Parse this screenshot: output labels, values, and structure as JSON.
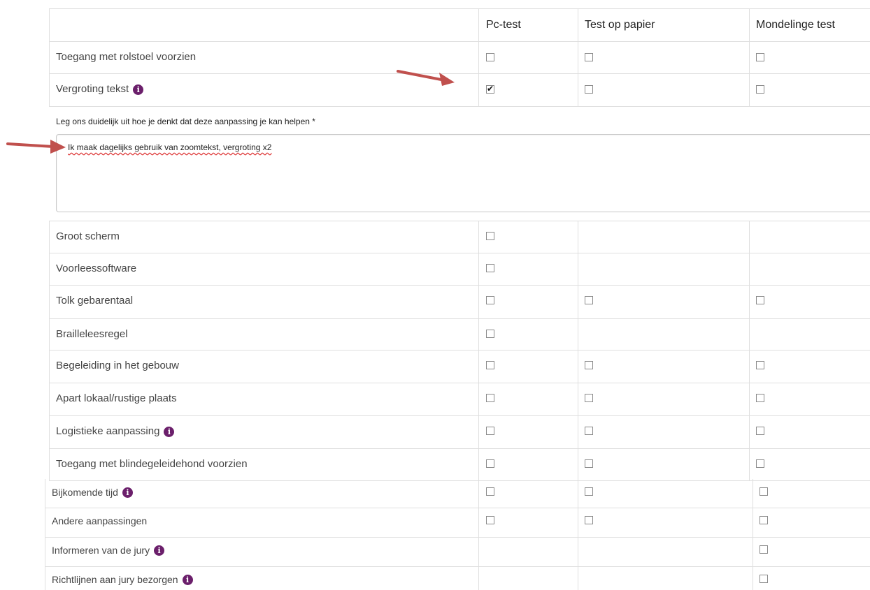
{
  "columns": [
    "Pc-test",
    "Test op papier",
    "Mondelinge test"
  ],
  "rows_top": [
    {
      "label": "Toegang met rolstoel voorzien",
      "info": false,
      "checks": [
        false,
        false,
        false
      ]
    },
    {
      "label": "Vergroting tekst",
      "info": true,
      "checks": [
        true,
        false,
        false
      ]
    }
  ],
  "explanation": {
    "label": "Leg ons duidelijk uit hoe je denkt dat deze aanpassing je kan helpen *",
    "value": "Ik maak dagelijks gebruik van zoomtekst, vergroting x2"
  },
  "rows_mid": [
    {
      "label": "Groot scherm",
      "info": false,
      "checks": [
        false,
        null,
        null
      ]
    },
    {
      "label": "Voorleessoftware",
      "info": false,
      "checks": [
        false,
        null,
        null
      ]
    },
    {
      "label": "Tolk gebarentaal",
      "info": false,
      "checks": [
        false,
        false,
        false
      ]
    },
    {
      "label": "Brailleleesregel",
      "info": false,
      "checks": [
        false,
        null,
        null
      ]
    },
    {
      "label": "Begeleiding in het gebouw",
      "info": false,
      "checks": [
        false,
        false,
        false
      ]
    },
    {
      "label": "Apart lokaal/rustige plaats",
      "info": false,
      "checks": [
        false,
        false,
        false
      ]
    },
    {
      "label": "Logistieke aanpassing",
      "info": true,
      "checks": [
        false,
        false,
        false
      ]
    },
    {
      "label": "Toegang met blindegeleidehond voorzien",
      "info": false,
      "checks": [
        false,
        false,
        false
      ]
    }
  ],
  "rows_bottom": [
    {
      "label": "Bijkomende tijd",
      "info": true,
      "checks": [
        false,
        false,
        false
      ]
    },
    {
      "label": "Andere aanpassingen",
      "info": false,
      "checks": [
        false,
        false,
        false
      ]
    },
    {
      "label": "Informeren van de jury",
      "info": true,
      "checks": [
        null,
        null,
        false
      ]
    },
    {
      "label": "Richtlijnen aan jury bezorgen",
      "info": true,
      "checks": [
        null,
        null,
        false
      ]
    }
  ],
  "info_icon_glyph": "i",
  "colors": {
    "info": "#6b1f6b",
    "arrow": "#c0504d",
    "grid": "#dfdfdf"
  }
}
